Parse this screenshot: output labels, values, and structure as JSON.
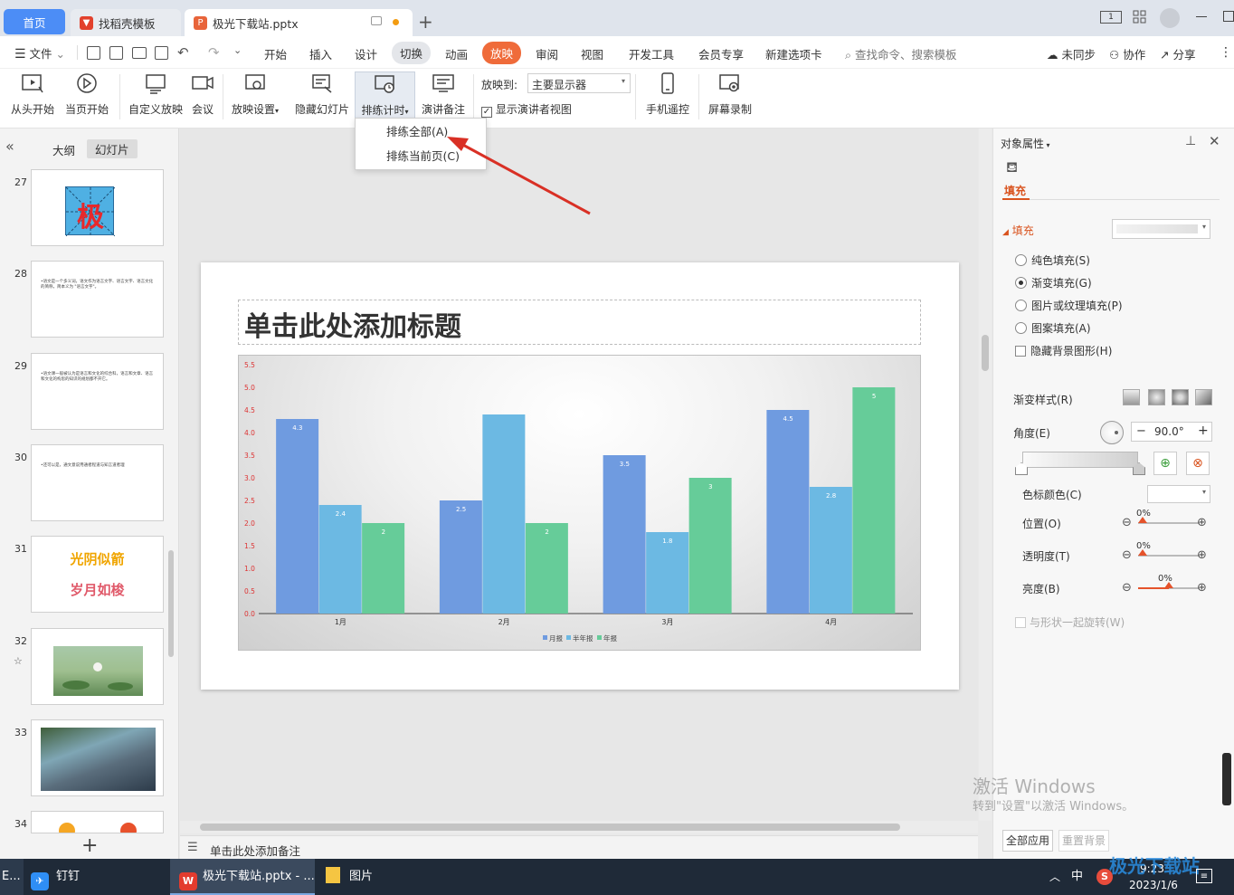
{
  "titlebar": {
    "tabs": [
      {
        "label": "首页"
      },
      {
        "label": "找稻壳模板"
      },
      {
        "label": "极光下载站.pptx"
      }
    ],
    "new_tab": "+",
    "page_count_badge": "1"
  },
  "menubar": {
    "file_label": "文件",
    "items": [
      "开始",
      "插入",
      "设计",
      "切换",
      "动画",
      "放映",
      "审阅",
      "视图",
      "开发工具",
      "会员专享",
      "新建选项卡"
    ],
    "active_item": "放映",
    "search_placeholder": "查找命令、搜索模板",
    "sync": "未同步",
    "collab": "协作",
    "share": "分享"
  },
  "ribbon": {
    "from_start": "从头开始",
    "from_current": "当页开始",
    "custom_show": "自定义放映",
    "meeting": "会议",
    "show_settings": "放映设置",
    "hide_slide": "隐藏幻灯片",
    "rehearse": "排练计时",
    "speaker_notes": "演讲备注",
    "show_to_label": "放映到:",
    "show_to_value": "主要显示器",
    "presenter_view": "显示演讲者视图",
    "phone_remote": "手机遥控",
    "screen_record": "屏幕录制"
  },
  "dropdown": {
    "items": [
      "排练全部(A)",
      "排练当前页(C)"
    ]
  },
  "leftpanel": {
    "tabs": [
      "大纲",
      "幻灯片"
    ],
    "collapse": "«",
    "add": "+",
    "slides": [
      {
        "num": "27",
        "text": "极"
      },
      {
        "num": "28",
        "text": "•语文是一个多义词，语文作为语言文字、语言文字、语言文化的简称，简本义为 \"语言文字\"。"
      },
      {
        "num": "29",
        "text": "•语文课一般被认为是语言和文化的综合科，语言和文章、语言和文化的构思的知识的规划都不开它。"
      },
      {
        "num": "30",
        "text": "•还可以是，通文意说用通者程道与知言道者理"
      },
      {
        "num": "31",
        "text": "光阴似箭",
        "text2": "岁月如梭"
      },
      {
        "num": "32",
        "star": "☆"
      },
      {
        "num": "33"
      },
      {
        "num": "34"
      }
    ]
  },
  "slide": {
    "title": "单击此处添加标题"
  },
  "chart_data": {
    "type": "bar",
    "categories": [
      "1月",
      "2月",
      "3月",
      "4月"
    ],
    "series": [
      {
        "name": "月报",
        "values": [
          4.3,
          2.5,
          3.5,
          4.5
        ],
        "color": "#6f9be0"
      },
      {
        "name": "半年报",
        "values": [
          2.4,
          4.4,
          1.8,
          2.8
        ],
        "color": "#6cb9e3"
      },
      {
        "name": "年报",
        "values": [
          2,
          2,
          3,
          5
        ],
        "color": "#66cc99"
      }
    ],
    "data_labels": [
      [
        "4.3",
        "2.4",
        "2"
      ],
      [
        "2.5",
        "",
        "2"
      ],
      [
        "3.5",
        "1.8",
        "3"
      ],
      [
        "4.5",
        "2.8",
        "5"
      ]
    ],
    "y_ticks": [
      "0.0",
      "0.5",
      "1.0",
      "1.5",
      "2.0",
      "2.5",
      "3.0",
      "3.5",
      "4.0",
      "4.5",
      "5.0",
      "5.5"
    ],
    "ylim": [
      0,
      5.5
    ],
    "legend_position": "bottom",
    "title": "",
    "xlabel": "",
    "ylabel": ""
  },
  "notes": {
    "placeholder": "单击此处添加备注"
  },
  "rightpanel": {
    "header": "对象属性",
    "tab_fill": "填充",
    "section_fill": "填充",
    "options": [
      {
        "label": "纯色填充(S)",
        "checked": false
      },
      {
        "label": "渐变填充(G)",
        "checked": true
      },
      {
        "label": "图片或纹理填充(P)",
        "checked": false
      },
      {
        "label": "图案填充(A)",
        "checked": false
      }
    ],
    "hide_bg": "隐藏背景图形(H)",
    "gradient_style": "渐变样式(R)",
    "angle_label": "角度(E)",
    "angle_value": "90.0°",
    "stop_color": "色标颜色(C)",
    "position": {
      "label": "位置(O)",
      "value": "0%"
    },
    "transparency": {
      "label": "透明度(T)",
      "value": "0%"
    },
    "brightness": {
      "label": "亮度(B)",
      "value": "0%"
    },
    "rotate_with_shape": "与形状一起旋转(W)",
    "apply_all": "全部应用",
    "reset_bg": "重置背景",
    "minus": "−",
    "plus": "+"
  },
  "watermark": {
    "line1": "激活 Windows",
    "line2": "转到\"设置\"以激活 Windows。"
  },
  "taskbar": {
    "edge_text": "E...",
    "apps": [
      {
        "label": "钉钉"
      },
      {
        "label": "极光下载站.pptx - ..."
      },
      {
        "label": "图片"
      }
    ],
    "ime": "中",
    "time": "9:23",
    "date": "2023/1/6",
    "brand": "极光下载站"
  }
}
